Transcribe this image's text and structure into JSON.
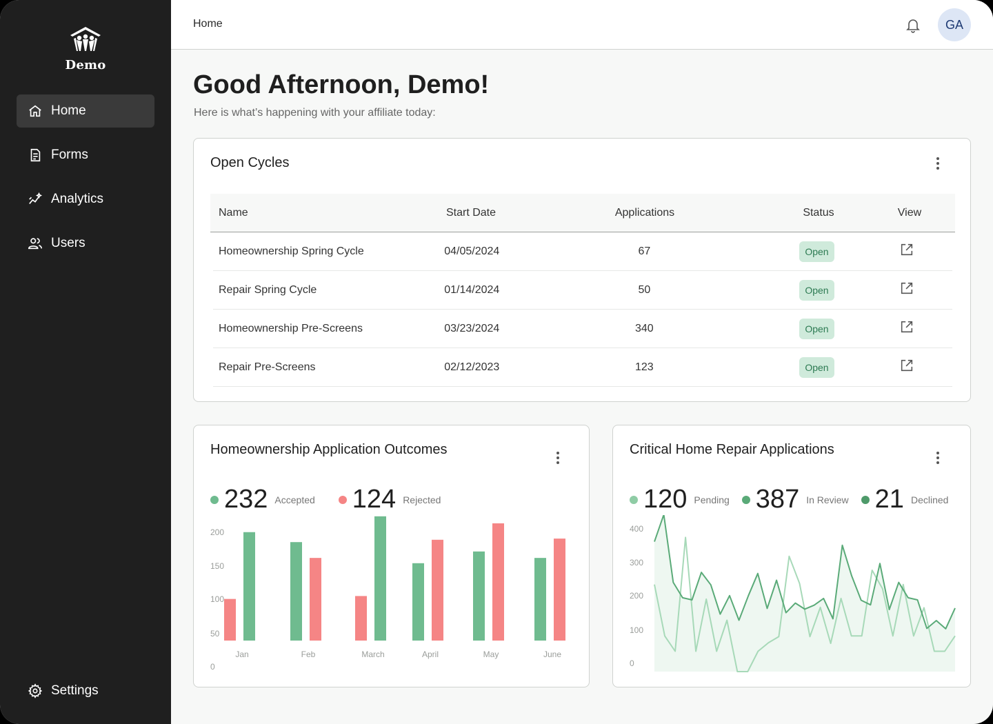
{
  "sidebar": {
    "brand": "Demo",
    "items": [
      {
        "label": "Home",
        "icon": "home-icon",
        "active": true
      },
      {
        "label": "Forms",
        "icon": "document-icon"
      },
      {
        "label": "Analytics",
        "icon": "analytics-icon"
      },
      {
        "label": "Users",
        "icon": "users-icon"
      }
    ],
    "settings": {
      "label": "Settings",
      "icon": "gear-icon"
    }
  },
  "topbar": {
    "breadcrumb": "Home",
    "avatar_initials": "GA"
  },
  "greeting": {
    "title": "Good Afternoon, Demo!",
    "subtitle": "Here is what’s happening with your affiliate today:"
  },
  "open_cycles": {
    "title": "Open Cycles",
    "columns": [
      "Name",
      "Start Date",
      "Applications",
      "Status",
      "View"
    ],
    "rows": [
      {
        "name": "Homeownership Spring Cycle",
        "start": "04/05/2024",
        "apps": "67",
        "status": "Open"
      },
      {
        "name": "Repair Spring Cycle",
        "start": "01/14/2024",
        "apps": "50",
        "status": "Open"
      },
      {
        "name": "Homeownership Pre-Screens",
        "start": "03/23/2024",
        "apps": "340",
        "status": "Open"
      },
      {
        "name": "Repair Pre-Screens",
        "start": "02/12/2023",
        "apps": "123",
        "status": "Open"
      }
    ]
  },
  "outcomes_card": {
    "title": "Homeownership Application Outcomes",
    "stats": [
      {
        "value": "232",
        "label": "Accepted",
        "color": "#6fbb8f"
      },
      {
        "value": "124",
        "label": "Rejected",
        "color": "#f58585"
      }
    ]
  },
  "repair_card": {
    "title": "Critical Home Repair Applications",
    "stats": [
      {
        "value": "120",
        "label": "Pending",
        "color": "#8fcca5"
      },
      {
        "value": "387",
        "label": "In Review",
        "color": "#5aaa78"
      },
      {
        "value": "21",
        "label": "Declined",
        "color": "#4e9a6a"
      }
    ]
  },
  "chart_data": [
    {
      "type": "bar",
      "title": "Homeownership Application Outcomes",
      "categories": [
        "Jan",
        "Feb",
        "March",
        "April",
        "May",
        "June"
      ],
      "yticks": [
        "200",
        "150",
        "100",
        "50",
        "0"
      ],
      "ylim": [
        0,
        200
      ],
      "series": [
        {
          "name": "Accepted",
          "color": "#6fbb8f",
          "values": [
            185,
            168,
            212,
            132,
            152,
            141
          ]
        },
        {
          "name": "Rejected",
          "color": "#f58585",
          "values": [
            71,
            141,
            76,
            172,
            200,
            174
          ]
        }
      ],
      "order": [
        [
          "Rejected",
          "Accepted"
        ],
        [
          "Accepted",
          "Rejected"
        ],
        [
          "Rejected",
          "Accepted"
        ],
        [
          "Accepted",
          "Rejected"
        ],
        [
          "Accepted",
          "Rejected"
        ],
        [
          "Accepted",
          "Rejected"
        ]
      ]
    },
    {
      "type": "area",
      "title": "Critical Home Repair Applications",
      "yticks": [
        "400",
        "300",
        "200",
        "100",
        "0"
      ],
      "ylim": [
        0,
        400
      ],
      "series": [
        {
          "name": "Pending",
          "color": "#a7d9b8",
          "values": [
            244,
            100,
            57,
            376,
            57,
            203,
            57,
            144,
            0,
            0,
            57,
            81,
            98,
            323,
            247,
            98,
            180,
            79,
            205,
            100,
            100,
            284,
            232,
            100,
            244,
            100,
            179,
            57,
            57,
            100
          ]
        },
        {
          "name": "In Review",
          "color": "#5aaa78",
          "values": [
            364,
            440,
            250,
            207,
            201,
            278,
            243,
            161,
            213,
            144,
            213,
            275,
            177,
            256,
            165,
            192,
            175,
            186,
            205,
            148,
            354,
            268,
            200,
            187,
            303,
            174,
            250,
            207,
            201,
            121,
            143,
            120,
            178
          ]
        }
      ]
    }
  ]
}
